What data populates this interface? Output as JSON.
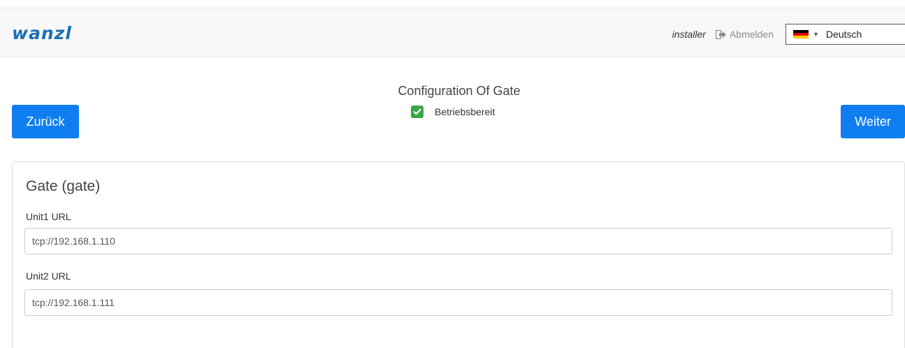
{
  "header": {
    "logo_text": "wanzl",
    "user": "installer",
    "logout_label": "Abmelden",
    "language": {
      "selected": "Deutsch",
      "flag_colors": [
        "#000000",
        "#dd0000",
        "#ffce00"
      ]
    }
  },
  "page": {
    "title": "Configuration Of Gate",
    "status_label": "Betriebsbereit",
    "back_label": "Zurück",
    "next_label": "Weiter"
  },
  "panel": {
    "title": "Gate (gate)",
    "fields": [
      {
        "label": "Unit1 URL",
        "value": "tcp://192.168.1.110"
      },
      {
        "label": "Unit2 URL",
        "value": "tcp://192.168.1.111"
      }
    ]
  },
  "colors": {
    "brand": "#1c6fb6",
    "primary_button": "#0f7ef0",
    "status_ok": "#3aa647"
  }
}
